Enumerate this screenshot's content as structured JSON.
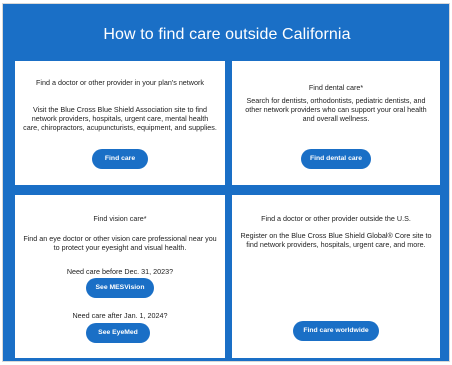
{
  "page": {
    "title": "How to find care outside California"
  },
  "cards": {
    "doctor_in_network": {
      "heading": "Find a doctor or other provider in your plan's network",
      "description": "Visit the Blue Cross Blue Shield Association site to find network providers, hospitals, urgent care, mental health care, chiropractors, acupuncturists, equipment, and supplies.",
      "button": "Find care"
    },
    "dental": {
      "heading": "Find dental care*",
      "description": "Search for dentists, orthodontists, pediatric dentists, and other network providers who can support your oral health and overall wellness.",
      "button": "Find dental care"
    },
    "vision": {
      "heading": "Find vision care*",
      "description": "Find an eye doctor or other vision care professional near you to protect your eyesight and visual health.",
      "note1": "Need care before Dec. 31, 2023?",
      "button1": "See MESVision",
      "note2": "Need care after Jan. 1, 2024?",
      "button2": "See EyeMed"
    },
    "outside_us": {
      "heading": "Find a doctor or other provider outside the U.S.",
      "description": "Register on the Blue Cross Blue Shield Global® Core site to find network providers, hospitals, urgent care, and more.",
      "button": "Find care worldwide"
    }
  },
  "colors": {
    "brand_blue": "#1a6fc6",
    "card_bg": "#ffffff",
    "text": "#222222"
  }
}
